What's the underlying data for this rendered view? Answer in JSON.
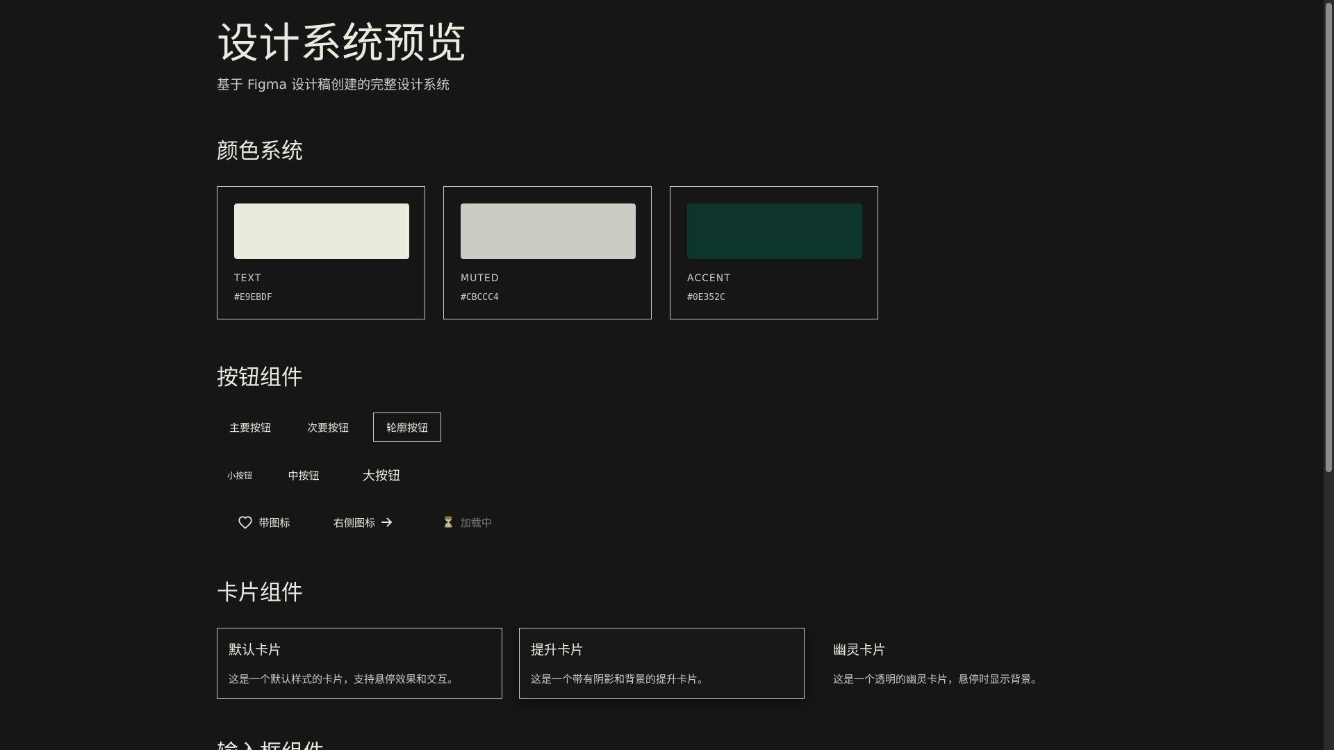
{
  "header": {
    "title": "设计系统预览",
    "subtitle": "基于 Figma 设计稿创建的完整设计系统"
  },
  "colors_section": {
    "title": "颜色系统",
    "swatches": [
      {
        "name": "TEXT",
        "hex": "#E9EBDF",
        "color": "#E9EBDF"
      },
      {
        "name": "MUTED",
        "hex": "#CBCCC4",
        "color": "#CBCCC4"
      },
      {
        "name": "ACCENT",
        "hex": "#0E352C",
        "color": "#0E352C"
      }
    ]
  },
  "buttons_section": {
    "title": "按钮组件",
    "variants": {
      "primary": "主要按钮",
      "secondary": "次要按钮",
      "outline": "轮廓按钮"
    },
    "sizes": {
      "small": "小按钮",
      "medium": "中按钮",
      "large": "大按钮"
    },
    "icons": {
      "with_icon": "带图标",
      "icon_right": "右侧图标",
      "loading": "加载中",
      "loading_glyph": "⏳"
    }
  },
  "cards_section": {
    "title": "卡片组件",
    "cards": [
      {
        "title": "默认卡片",
        "description": "这是一个默认样式的卡片，支持悬停效果和交互。"
      },
      {
        "title": "提升卡片",
        "description": "这是一个带有阴影和背景的提升卡片。"
      },
      {
        "title": "幽灵卡片",
        "description": "这是一个透明的幽灵卡片，悬停时显示背景。"
      }
    ]
  },
  "inputs_section": {
    "title": "输入框组件"
  }
}
